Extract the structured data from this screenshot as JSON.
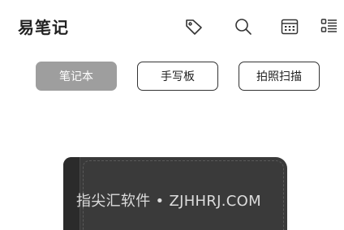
{
  "header": {
    "title": "易笔记",
    "actions": [
      {
        "name": "tag-icon"
      },
      {
        "name": "search-icon"
      },
      {
        "name": "calendar-icon"
      },
      {
        "name": "list-view-icon"
      }
    ]
  },
  "tabs": [
    {
      "label": "笔记本",
      "active": true
    },
    {
      "label": "手写板",
      "active": false
    },
    {
      "label": "拍照扫描",
      "active": false
    }
  ],
  "colors": {
    "active_tab_bg": "#9e9e9e",
    "notebook_cover": "#3a3a3a",
    "title_text": "#222222"
  },
  "watermark": "指尖汇软件 • ZJHHRJ.COM"
}
